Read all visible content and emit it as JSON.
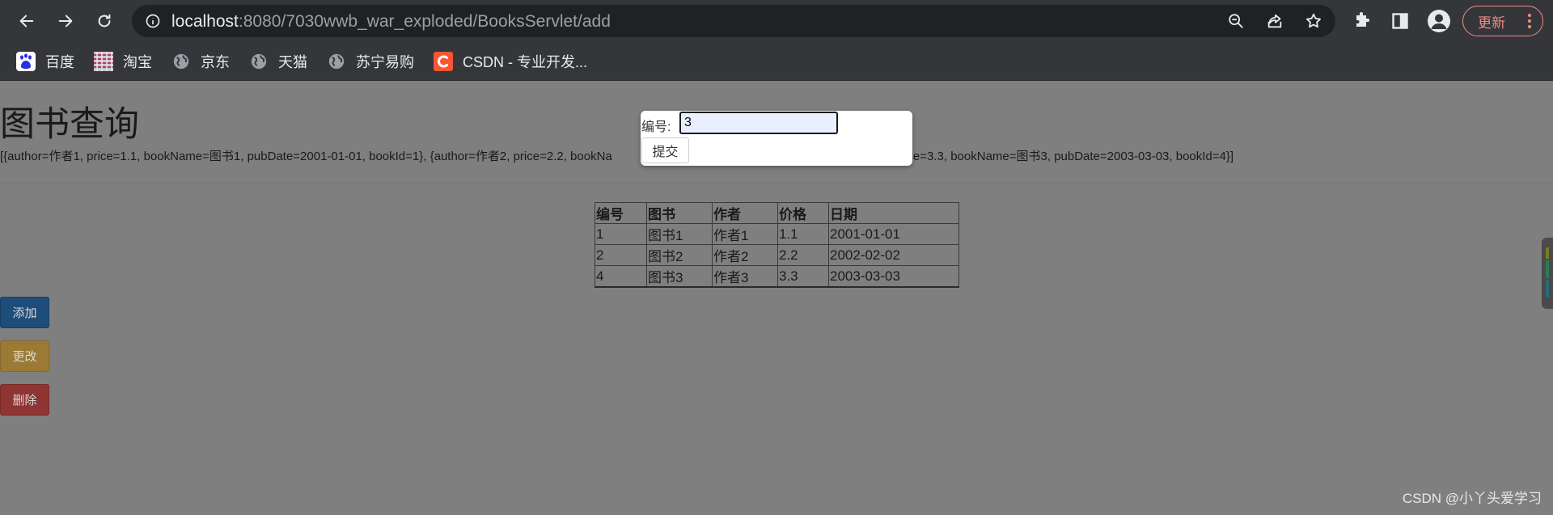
{
  "browser": {
    "url_host": "localhost",
    "url_rest": ":8080/7030wwb_war_exploded/BooksServlet/add",
    "update_label": "更新",
    "bookmarks": [
      {
        "label": "百度",
        "icon": "baidu-icon"
      },
      {
        "label": "淘宝",
        "icon": "taobao-icon"
      },
      {
        "label": "京东",
        "icon": "globe-icon"
      },
      {
        "label": "天猫",
        "icon": "globe-icon"
      },
      {
        "label": "苏宁易购",
        "icon": "globe-icon"
      },
      {
        "label": "CSDN - 专业开发...",
        "icon": "csdn-icon"
      }
    ]
  },
  "page": {
    "title": "图书查询",
    "raw_list": "[{author=作者1, price=1.1, bookName=图书1, pubDate=2001-01-01, bookId=1}, {author=作者2, price=2.2, bookNa                                                            author=作者3, price=3.3, bookName=图书3, pubDate=2003-03-03, bookId=4}]",
    "table": {
      "headers": [
        "编号",
        "图书",
        "作者",
        "价格",
        "日期"
      ],
      "rows": [
        [
          "1",
          "图书1",
          "作者1",
          "1.1",
          "2001-01-01"
        ],
        [
          "2",
          "图书2",
          "作者2",
          "2.2",
          "2002-02-02"
        ],
        [
          "4",
          "图书3",
          "作者3",
          "3.3",
          "2003-03-03"
        ]
      ]
    },
    "buttons": {
      "add": "添加",
      "edit": "更改",
      "delete": "删除"
    },
    "watermark": "CSDN @小丫头爱学习"
  },
  "popup": {
    "label": "编号:",
    "value": "3",
    "submit": "提交"
  },
  "colors": {
    "overlay_bg": "#7f7f7f",
    "chrome_bg": "#35363a",
    "update_accent": "#f28b82",
    "add_btn": "#1f4d79",
    "edit_btn": "#9b7a35",
    "delete_btn": "#8e3433"
  }
}
